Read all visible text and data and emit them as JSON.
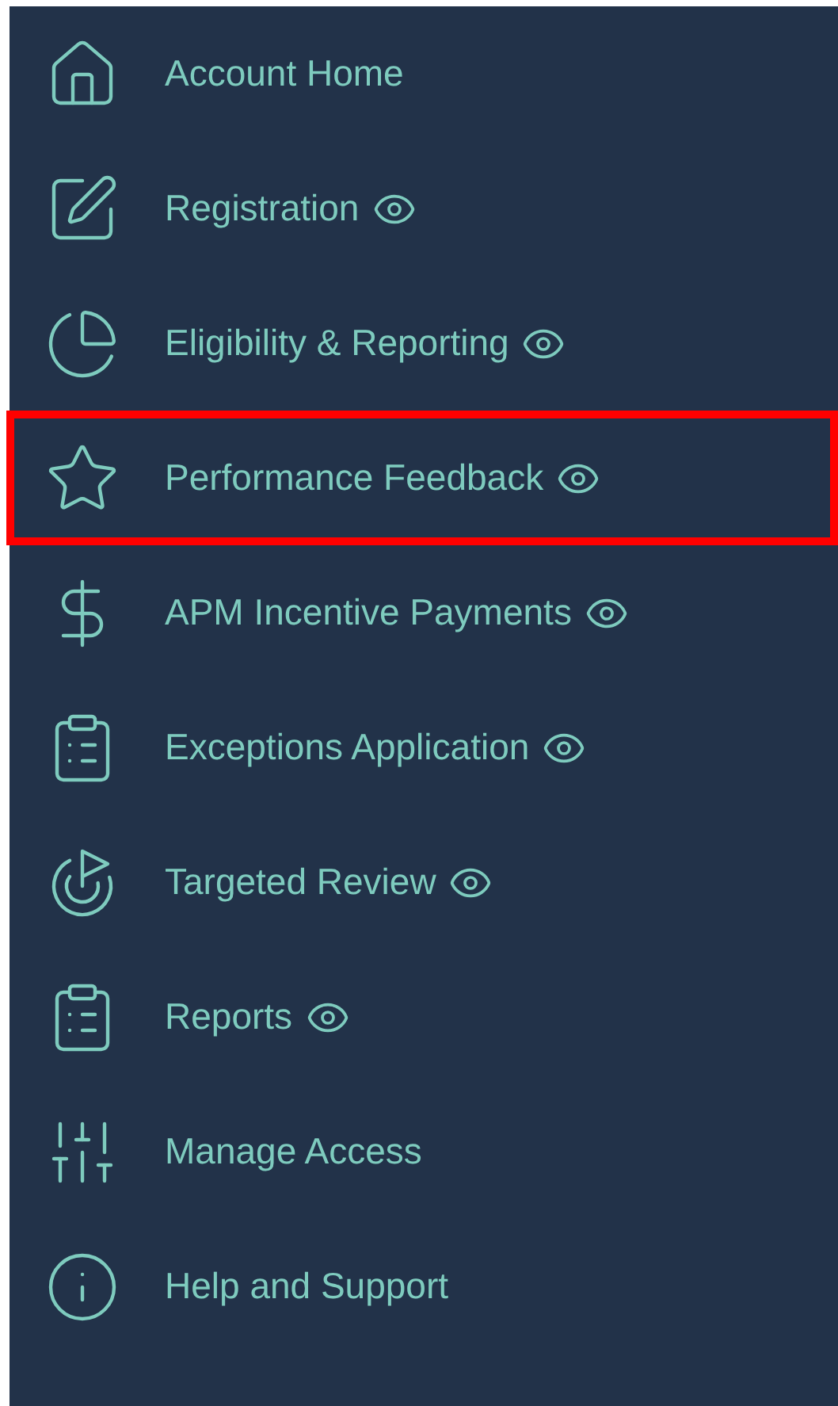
{
  "nav_items": [
    {
      "label": "Account Home",
      "viewable": false,
      "highlighted": false
    },
    {
      "label": "Registration",
      "viewable": true,
      "highlighted": false
    },
    {
      "label": "Eligibility & Reporting",
      "viewable": true,
      "highlighted": false
    },
    {
      "label": "Performance Feedback",
      "viewable": true,
      "highlighted": true
    },
    {
      "label": "APM Incentive Payments",
      "viewable": true,
      "highlighted": false
    },
    {
      "label": "Exceptions Application",
      "viewable": true,
      "highlighted": false
    },
    {
      "label": "Targeted Review",
      "viewable": true,
      "highlighted": false
    },
    {
      "label": "Reports",
      "viewable": true,
      "highlighted": false
    },
    {
      "label": "Manage Access",
      "viewable": false,
      "highlighted": false
    },
    {
      "label": "Help and Support",
      "viewable": false,
      "highlighted": false
    }
  ]
}
